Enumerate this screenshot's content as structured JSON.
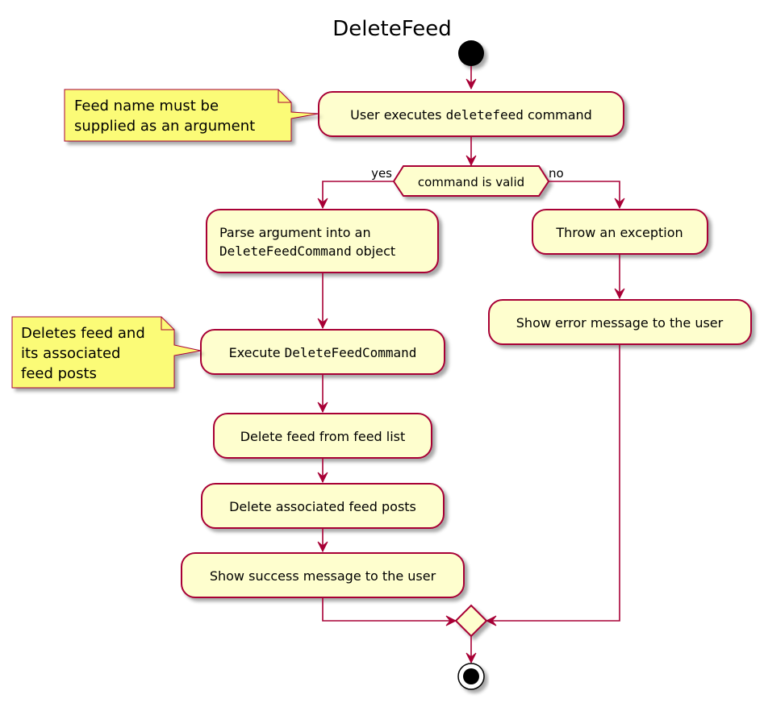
{
  "diagram": {
    "title": "DeleteFeed",
    "colors": {
      "activity_fill": "#FEFECE",
      "border": "#A80036",
      "note_fill": "#FBFB77",
      "start_end": "#000000"
    },
    "activities": {
      "user_executes": {
        "prefix": "User executes ",
        "code": "deletefeed",
        "suffix": " command"
      },
      "decision": {
        "label": "command is valid",
        "yes_label": "yes",
        "no_label": "no"
      },
      "parse_argument": {
        "line1": "Parse argument into an",
        "code": "DeleteFeedCommand",
        "line2_suffix": " object"
      },
      "execute_command": {
        "prefix": "Execute ",
        "code": "DeleteFeedCommand"
      },
      "delete_feed": {
        "label": "Delete feed from feed list"
      },
      "delete_posts": {
        "label": "Delete associated feed posts"
      },
      "show_success": {
        "label": "Show success message to the user"
      },
      "throw_exception": {
        "label": "Throw an exception"
      },
      "show_error": {
        "label": "Show error message to the user"
      }
    },
    "notes": {
      "feed_name": {
        "lines": [
          "Feed name must be",
          "supplied as an argument"
        ]
      },
      "deletes_feed": {
        "lines": [
          "Deletes feed and",
          "its associated",
          "feed posts"
        ]
      }
    }
  }
}
